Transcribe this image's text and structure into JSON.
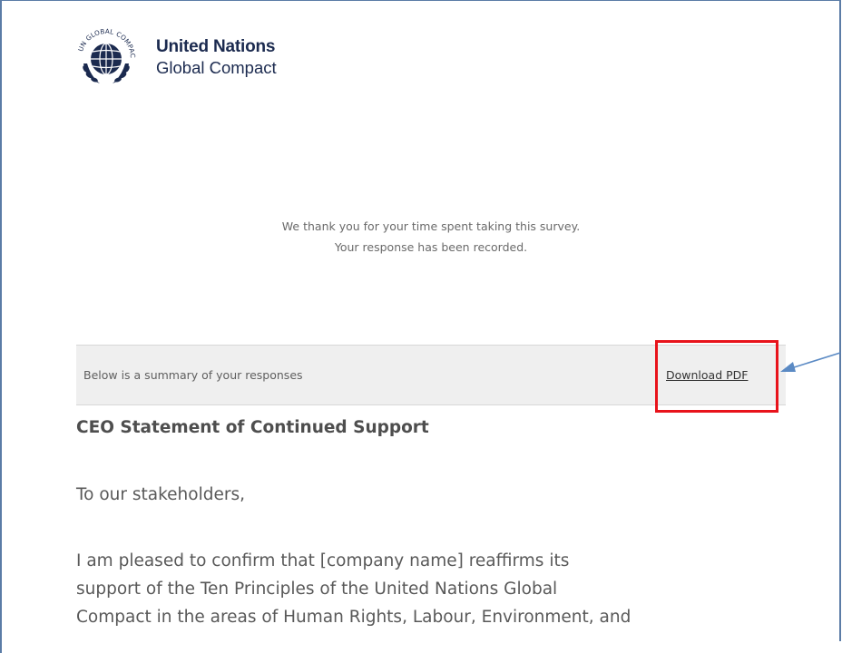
{
  "logo": {
    "emblem_text": "UN GLOBAL COMPACT",
    "line1": "United Nations",
    "line2": "Global Compact"
  },
  "thanks": {
    "line1": "We thank you for your time spent taking this survey.",
    "line2": "Your response has been recorded."
  },
  "summary": {
    "label": "Below is a summary of your responses",
    "download_label": "Download PDF"
  },
  "statement": {
    "title": "CEO Statement of Continued Support",
    "salutation": "To our stakeholders,",
    "body_lines": [
      "I am pleased to confirm that [company name] reaffirms its",
      "support of the Ten Principles of the United Nations Global",
      "Compact in the areas of Human Rights, Labour, Environment, and"
    ]
  },
  "colors": {
    "highlight": "#e8131b",
    "arrow": "#5b8ac4",
    "brand_navy": "#1b2a4f"
  },
  "icons": {
    "logo": "un-global-compact-emblem",
    "callout": "arrow-icon"
  }
}
